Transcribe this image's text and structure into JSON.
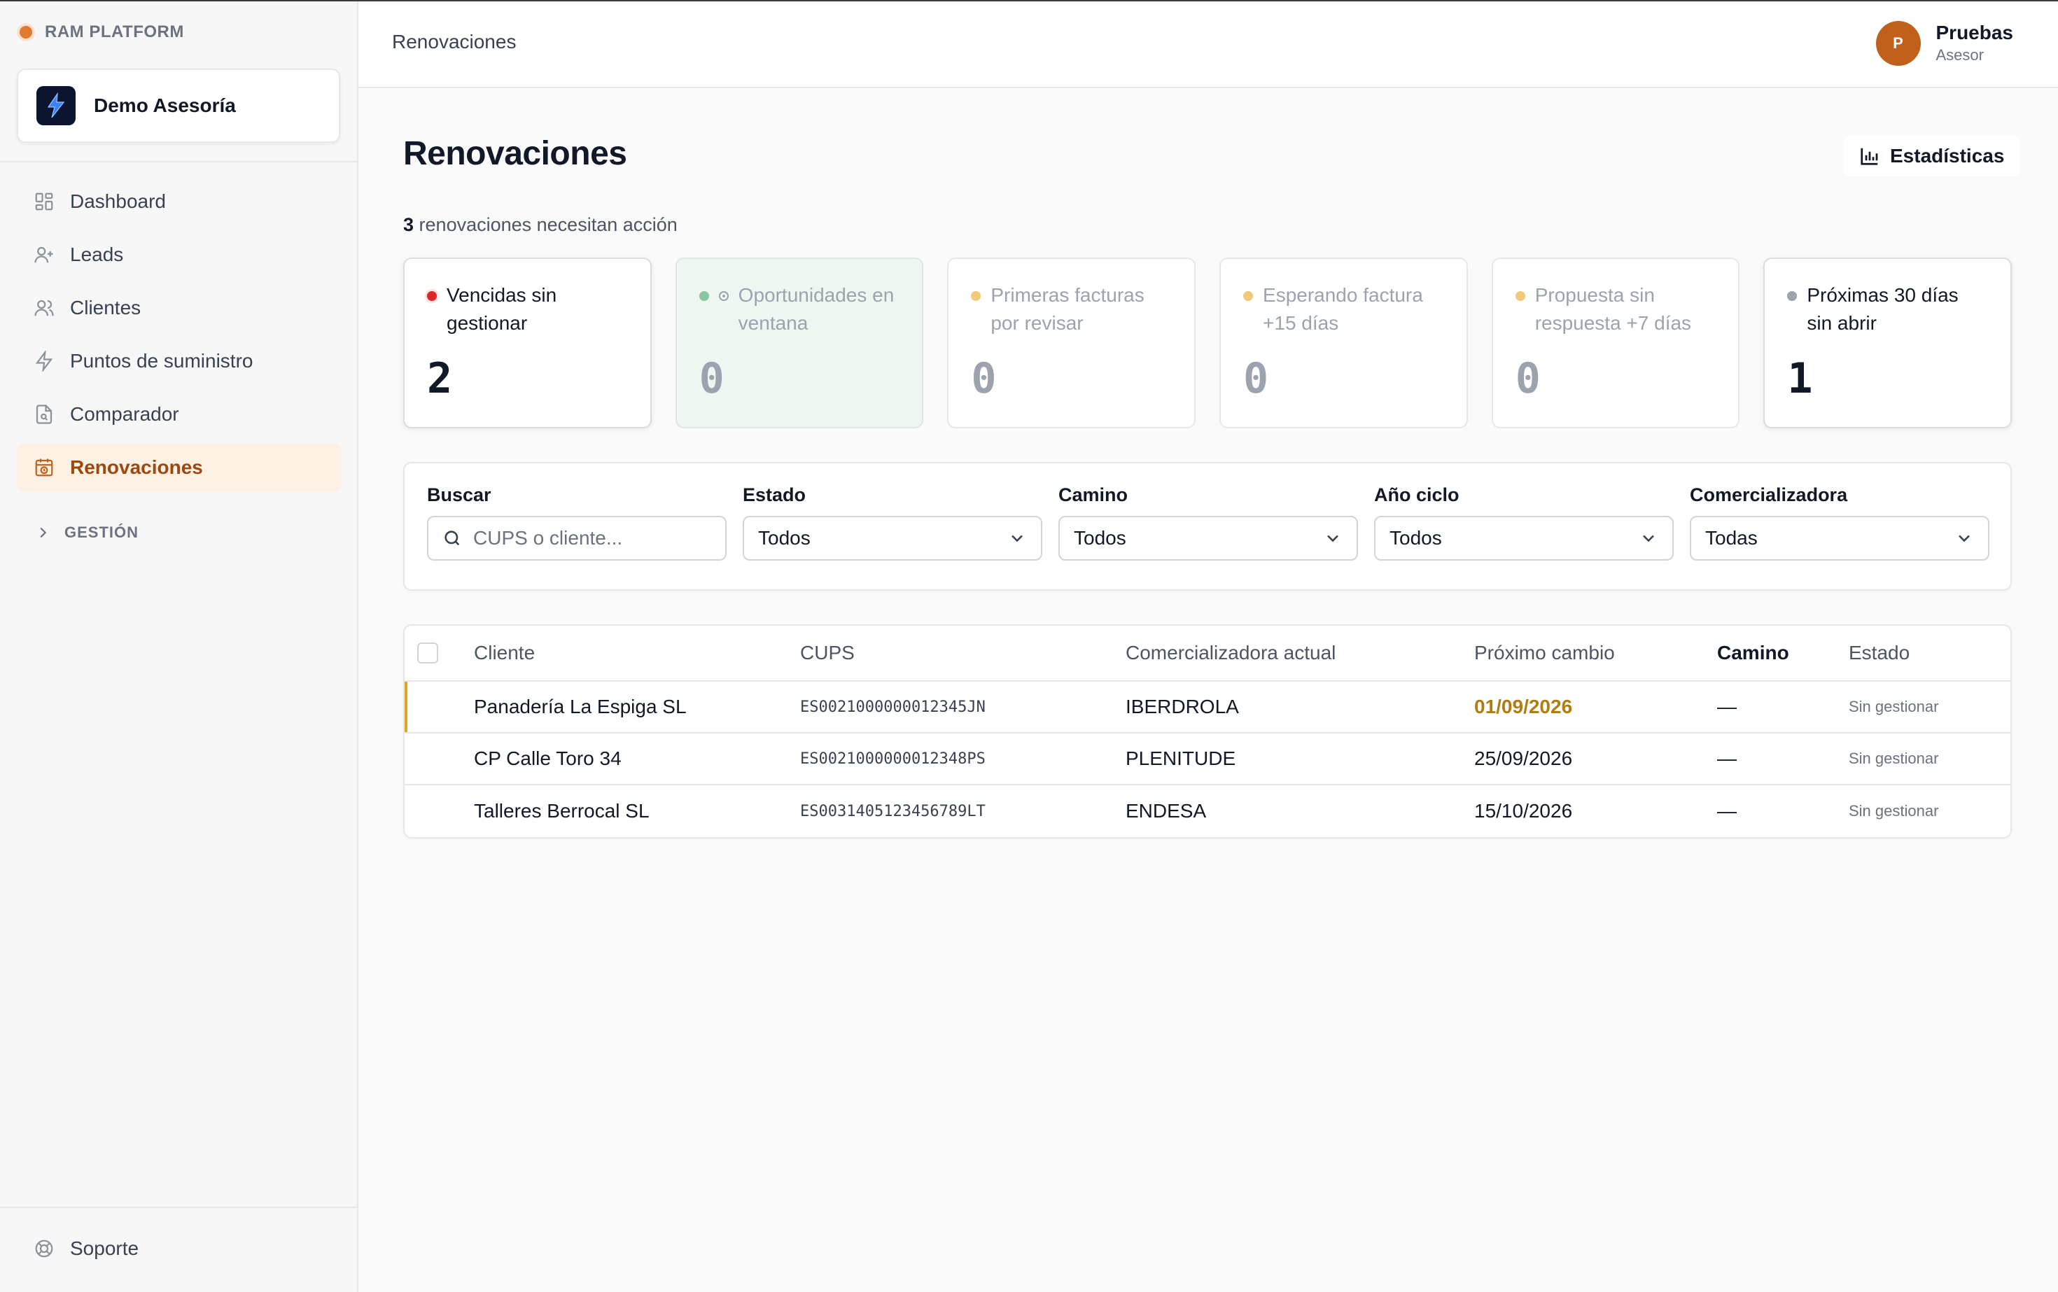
{
  "app": {
    "brand": "RAM PLATFORM",
    "org_name": "Demo Asesoría"
  },
  "sidebar": {
    "items": [
      {
        "label": "Dashboard",
        "icon": "dashboard-icon"
      },
      {
        "label": "Leads",
        "icon": "user-plus-icon"
      },
      {
        "label": "Clientes",
        "icon": "users-icon"
      },
      {
        "label": "Puntos de suministro",
        "icon": "bolt-icon"
      },
      {
        "label": "Comparador",
        "icon": "document-search-icon"
      },
      {
        "label": "Renovaciones",
        "icon": "calendar-clock-icon",
        "active": true
      }
    ],
    "group_label": "GESTIÓN",
    "support_label": "Soporte"
  },
  "header": {
    "title": "Renovaciones",
    "user": {
      "initial": "P",
      "name": "Pruebas",
      "role": "Asesor"
    }
  },
  "main": {
    "title": "Renovaciones",
    "stats_button": "Estadísticas",
    "summary_count": "3",
    "summary_text": "renovaciones necesitan acción",
    "cards": [
      {
        "label": "Vencidas sin gestionar",
        "value": "2",
        "dot_color": "#dc2626"
      },
      {
        "label": "Oportunidades en ventana",
        "value": "0",
        "dot_color": "#86c6a0"
      },
      {
        "label": "Primeras facturas por revisar",
        "value": "0",
        "dot_color": "#f2c879"
      },
      {
        "label": "Esperando factura +15 días",
        "value": "0",
        "dot_color": "#f2c879"
      },
      {
        "label": "Propuesta sin respuesta +7 días",
        "value": "0",
        "dot_color": "#f2c879"
      },
      {
        "label": "Próximas 30 días sin abrir",
        "value": "1",
        "dot_color": "#9ca3af"
      }
    ]
  },
  "filters": {
    "search": {
      "label": "Buscar",
      "placeholder": "CUPS o cliente..."
    },
    "estado": {
      "label": "Estado",
      "value": "Todos"
    },
    "camino": {
      "label": "Camino",
      "value": "Todos"
    },
    "anio": {
      "label": "Año ciclo",
      "value": "Todos"
    },
    "comercializadora": {
      "label": "Comercializadora",
      "value": "Todas"
    }
  },
  "table": {
    "columns": [
      "Cliente",
      "CUPS",
      "Comercializadora actual",
      "Próximo cambio",
      "Camino",
      "Estado"
    ],
    "rows": [
      {
        "cliente": "Panadería La Espiga SL",
        "cups": "ES0021000000012345JN",
        "comercializadora": "IBERDROLA",
        "proximo": "01/09/2026",
        "camino": "—",
        "estado": "Sin gestionar"
      },
      {
        "cliente": "CP Calle Toro 34",
        "cups": "ES0021000000012348PS",
        "comercializadora": "PLENITUDE",
        "proximo": "25/09/2026",
        "camino": "—",
        "estado": "Sin gestionar"
      },
      {
        "cliente": "Talleres Berrocal SL",
        "cups": "ES0031405123456789LT",
        "comercializadora": "ENDESA",
        "proximo": "15/10/2026",
        "camino": "—",
        "estado": "Sin gestionar"
      }
    ]
  },
  "colors": {
    "accent": "#c0601b",
    "active_bg": "#fdf1e4",
    "highlight_date": "#b07d11",
    "row_marker": "#e0a526"
  }
}
